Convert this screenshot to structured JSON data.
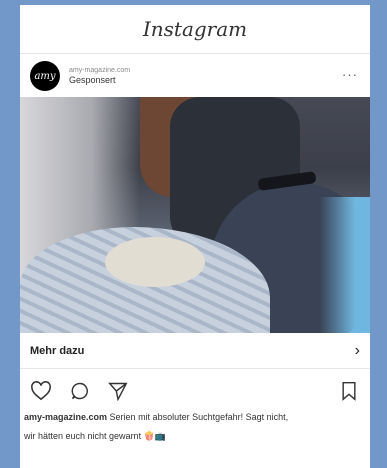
{
  "app": {
    "brand": "Instagram"
  },
  "post": {
    "avatar_text": "amy",
    "handle": "amy-magazine.com",
    "sponsored_label": "Gesponsert",
    "more_label": "···"
  },
  "cta": {
    "label": "Mehr dazu",
    "chevron": "›"
  },
  "actions": {
    "icons": [
      "heart-icon",
      "comment-icon",
      "share-icon",
      "bookmark-icon"
    ]
  },
  "caption": {
    "username": "amy-magazine.com",
    "line1": "Serien mit absoluter Suchtgefahr! Sagt nicht,",
    "line2": "wir hätten euch nicht gewarnt",
    "emoji": "🍿📺"
  },
  "colors": {
    "background": "#7198c9",
    "card": "#ffffff"
  }
}
